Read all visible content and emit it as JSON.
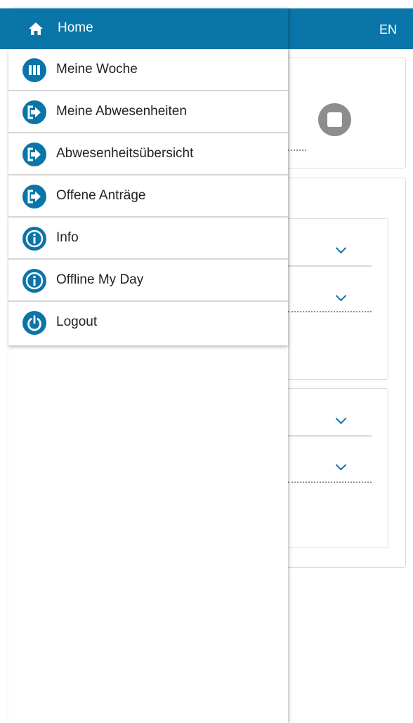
{
  "topbar": {
    "language": "EN"
  },
  "drawer": {
    "header": {
      "label": "Home",
      "icon": "home-icon"
    },
    "items": [
      {
        "label": "Meine Woche",
        "icon": "week-columns-icon"
      },
      {
        "label": "Meine Abwesenheiten",
        "icon": "arrow-right-exit-icon"
      },
      {
        "label": "Abwesenheitsübersicht",
        "icon": "arrow-right-exit-icon"
      },
      {
        "label": "Offene Anträge",
        "icon": "arrow-right-exit-icon"
      },
      {
        "label": "Info",
        "icon": "info-icon"
      },
      {
        "label": "Offline My Day",
        "icon": "info-icon"
      },
      {
        "label": "Logout",
        "icon": "power-icon"
      }
    ]
  },
  "colors": {
    "brand_blue": "#0a75a8",
    "stop_button_gray": "#8d8d8d",
    "text_dark": "#222222"
  }
}
